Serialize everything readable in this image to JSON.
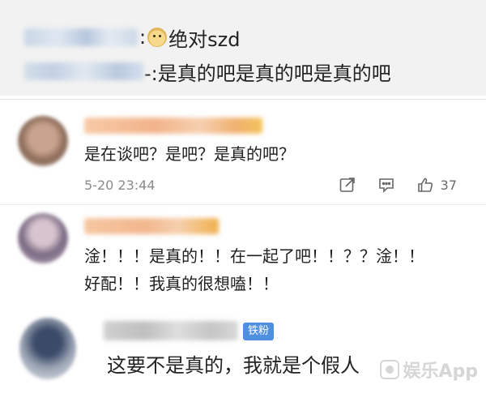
{
  "quote": {
    "line1_text": "绝对szd",
    "line2_text": "-:是真的吧是真的吧是真的吧",
    "colon": ":"
  },
  "comments": [
    {
      "text": "是在谈吧？是吧？是真的吧？",
      "timestamp": "5-20 23:44",
      "like_count": "37"
    },
    {
      "text_line1": "淦！！！是真的！！在一起了吧！！？？淦！！",
      "text_line2": "好配！！我真的很想嗑！！"
    },
    {
      "badge": "铁粉",
      "text": "这要不是真的，我就是个假人"
    }
  ],
  "watermark": {
    "text": "娱乐App"
  },
  "icons": {
    "doge": "doge-emoji-icon",
    "share": "share-icon",
    "comment": "comment-icon",
    "like": "like-icon",
    "watermark": "app-logo-icon"
  },
  "colors": {
    "badge": "#4f8fe0",
    "quote_background": "#f2f2f2",
    "timestamp": "#8a8a8a"
  }
}
